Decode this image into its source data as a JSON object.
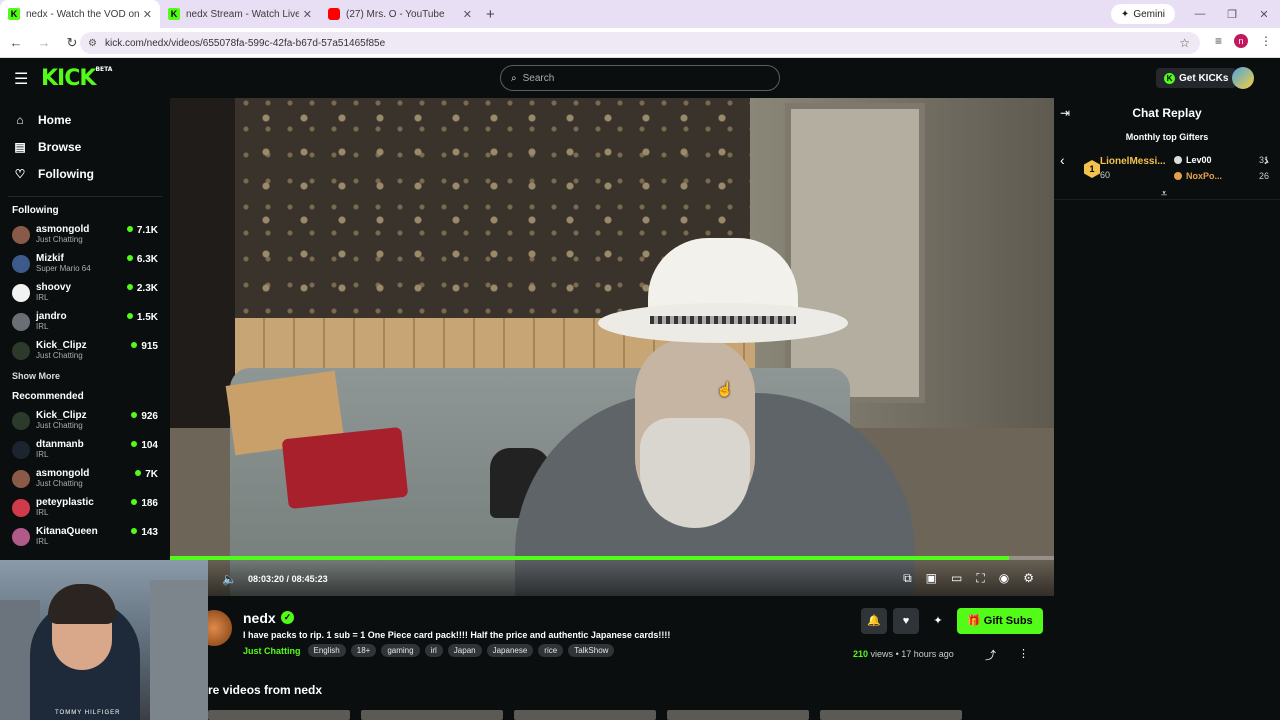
{
  "browser": {
    "tabs": [
      {
        "title": "nedx - Watch the VOD on Kick",
        "favicon": "kick-icon",
        "active": true
      },
      {
        "title": "nedx Stream - Watch Live on K...",
        "favicon": "kick-icon",
        "active": false
      },
      {
        "title": "(27) Mrs. O - YouTube",
        "favicon": "youtube-icon",
        "active": false
      }
    ],
    "gemini_label": "Gemini",
    "url": "kick.com/nedx/videos/655078fa-599c-42fa-b67d-57a51465f85e",
    "profile_initial": "n"
  },
  "header": {
    "logo_text": "KICK",
    "logo_badge": "BETA",
    "search_placeholder": "Search",
    "get_kicks_label": "Get KICKs"
  },
  "sidebar": {
    "nav": [
      {
        "label": "Home",
        "icon": "home-icon"
      },
      {
        "label": "Browse",
        "icon": "browse-icon"
      },
      {
        "label": "Following",
        "icon": "heart-icon"
      }
    ],
    "following_title": "Following",
    "following": [
      {
        "name": "asmongold",
        "category": "Just Chatting",
        "viewers": "7.1K",
        "avatar_color": "#8a5a48"
      },
      {
        "name": "Mizkif",
        "category": "Super Mario 64",
        "viewers": "6.3K",
        "avatar_color": "#3d5a8a"
      },
      {
        "name": "shoovy",
        "category": "IRL",
        "viewers": "2.3K",
        "avatar_color": "#f2f2f2"
      },
      {
        "name": "jandro",
        "category": "IRL",
        "viewers": "1.5K",
        "avatar_color": "#6a6f75"
      },
      {
        "name": "Kick_Clipz",
        "category": "Just Chatting",
        "viewers": "915",
        "avatar_color": "#2b3a2b"
      }
    ],
    "show_more": "Show More",
    "recommended_title": "Recommended",
    "recommended": [
      {
        "name": "Kick_Clipz",
        "category": "Just Chatting",
        "viewers": "926",
        "avatar_color": "#2b3a2b"
      },
      {
        "name": "dtanmanb",
        "category": "IRL",
        "viewers": "104",
        "avatar_color": "#1c2430"
      },
      {
        "name": "asmongold",
        "category": "Just Chatting",
        "viewers": "7K",
        "avatar_color": "#8a5a48"
      },
      {
        "name": "peteyplastic",
        "category": "IRL",
        "viewers": "186",
        "avatar_color": "#d13a4a"
      },
      {
        "name": "KitanaQueen",
        "category": "IRL",
        "viewers": "143",
        "avatar_color": "#b05a8a"
      }
    ]
  },
  "player": {
    "time_current": "08:03:20",
    "time_separator": "/",
    "time_total": "08:45:23",
    "progress_fraction": 0.9488,
    "control_icons": [
      "mini-player-icon",
      "theater-icon",
      "captions-icon",
      "fullscreen-icon",
      "autoplay-icon",
      "settings-icon"
    ]
  },
  "stream": {
    "streamer": "nedx",
    "title": "I have packs to rip. 1 sub = 1 One Piece card pack!!!! Half the price and authentic Japanese cards!!!!",
    "category": "Just Chatting",
    "tags": [
      "English",
      "18+",
      "gaming",
      "irl",
      "Japan",
      "Japanese",
      "rice",
      "TalkShow"
    ],
    "views_count": "210",
    "views_label": "views",
    "dot": "•",
    "age": "17 hours ago",
    "gift_subs_label": "Gift Subs",
    "more_videos_title": "re videos from nedx",
    "thumb_durations": [
      "",
      "",
      "",
      "",
      "",
      ""
    ]
  },
  "webcam": {
    "brand_text": "TOMMY HILFIGER"
  },
  "chat": {
    "title": "Chat Replay",
    "monthly_title": "Monthly top Gifters",
    "top_gifter": {
      "rank": "1",
      "name": "LionelMessi...",
      "count": "60"
    },
    "gifters": [
      {
        "name": "Lev00",
        "count": "31",
        "color": "#ffffff"
      },
      {
        "name": "NoxPo...",
        "count": "26",
        "color": "#e3a24a"
      }
    ]
  },
  "colors": {
    "accent": "#53fc18",
    "background": "#0b0e0f"
  }
}
